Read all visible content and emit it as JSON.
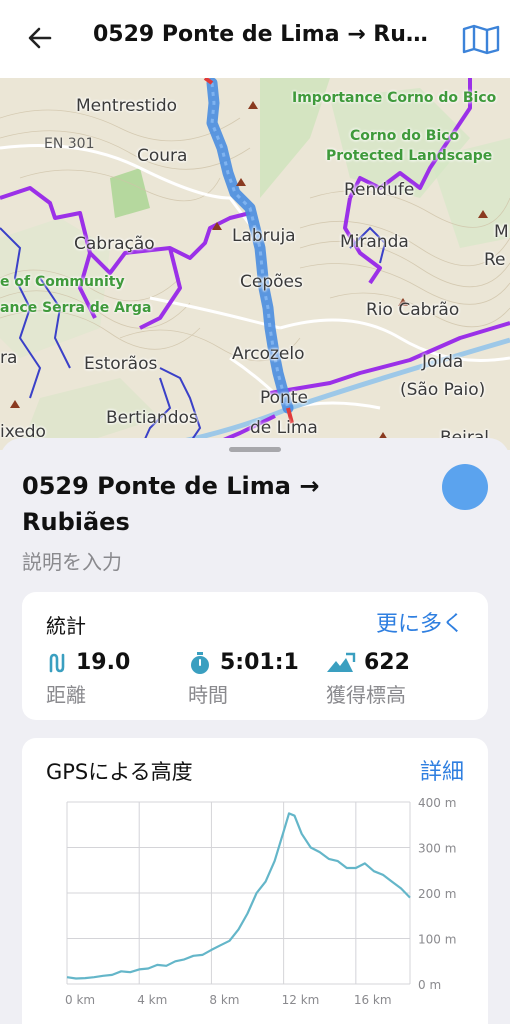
{
  "appbar": {
    "title": "0529 Ponte de Lima → Rub..."
  },
  "map": {
    "places": [
      {
        "name": "Mentrestido"
      },
      {
        "name": "Coura"
      },
      {
        "name": "Cabração"
      },
      {
        "name": "Labruja"
      },
      {
        "name": "Cepões"
      },
      {
        "name": "Arcozelo"
      },
      {
        "name": "Estorãos"
      },
      {
        "name": "Bertiandos"
      },
      {
        "name": "Ponte"
      },
      {
        "name": "de Lima"
      },
      {
        "name": "Rendufe"
      },
      {
        "name": "Miranda"
      },
      {
        "name": "Rio Cabrão"
      },
      {
        "name": "Jolda"
      },
      {
        "name": "(São Paio)"
      },
      {
        "name": "ixedo"
      },
      {
        "name": "Beiral"
      },
      {
        "name": "M"
      },
      {
        "name": "Re"
      },
      {
        "name": "ra"
      }
    ],
    "road": "EN 301",
    "protected_labels": [
      "Importance Corno do Bico",
      "Corno do Bico",
      "Protected Landscape",
      "e of Community",
      "ance Serra de Arga"
    ],
    "route_color": "#4a8de0",
    "trail_color": "#9b30e8"
  },
  "track": {
    "title": "0529 Ponte de Lima → Rubiães",
    "description_placeholder": "説明を入力",
    "color": "#5ba3ee"
  },
  "stats": {
    "title": "統計",
    "more_label": "更に多く",
    "distance": {
      "value": "19.0",
      "label": "距離",
      "icon": "distance-icon"
    },
    "time": {
      "value": "5:01:1",
      "label": "時間",
      "icon": "stopwatch-icon"
    },
    "ascent": {
      "value": "622",
      "label": "獲得標高",
      "icon": "ascent-icon"
    }
  },
  "elevation": {
    "title": "GPSによる高度",
    "detail_label": "詳細"
  },
  "chart_data": {
    "type": "area",
    "title": "GPSによる高度",
    "x_unit": "km",
    "y_unit": "m",
    "xlim": [
      0,
      19.0
    ],
    "ylim": [
      0,
      400
    ],
    "x_ticks": [
      "0 km",
      "4 km",
      "8 km",
      "12 km",
      "16 km"
    ],
    "y_ticks": [
      "0 m",
      "100 m",
      "200 m",
      "300 m",
      "400 m"
    ],
    "grid": true,
    "line_color": "#64b6c9",
    "series": [
      {
        "x": [
          0,
          0.5,
          1,
          1.5,
          2,
          2.5,
          3,
          3.5,
          4,
          4.5,
          5,
          5.5,
          6,
          6.5,
          7,
          7.5,
          8,
          8.5,
          9,
          9.5,
          10,
          10.5,
          11,
          11.5,
          12,
          12.3,
          12.6,
          13,
          13.5,
          14,
          14.5,
          15,
          15.5,
          16,
          16.5,
          17,
          17.5,
          18,
          18.5,
          19
        ],
        "y": [
          15,
          12,
          13,
          15,
          18,
          20,
          28,
          26,
          32,
          34,
          42,
          40,
          50,
          54,
          62,
          64,
          75,
          85,
          95,
          120,
          155,
          200,
          225,
          270,
          335,
          375,
          370,
          330,
          300,
          290,
          275,
          270,
          255,
          255,
          265,
          248,
          240,
          225,
          210,
          190
        ]
      }
    ]
  }
}
